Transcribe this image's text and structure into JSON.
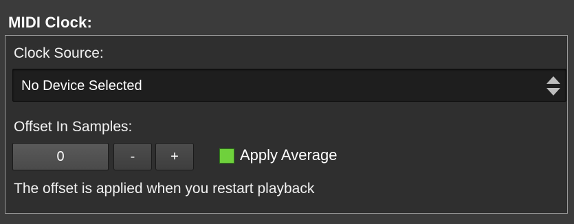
{
  "midi_clock": {
    "title": "MIDI Clock:",
    "clock_source": {
      "label": "Clock Source:",
      "selected_value": "No Device Selected",
      "arrow_icon": "up-down-chevron-icon"
    },
    "offset": {
      "label": "Offset In Samples:",
      "value": "0",
      "minus_label": "-",
      "plus_label": "+"
    },
    "apply_average": {
      "label": "Apply Average",
      "checked": true,
      "color": "#6fd13c"
    },
    "note": "The offset is applied when you restart playback"
  }
}
